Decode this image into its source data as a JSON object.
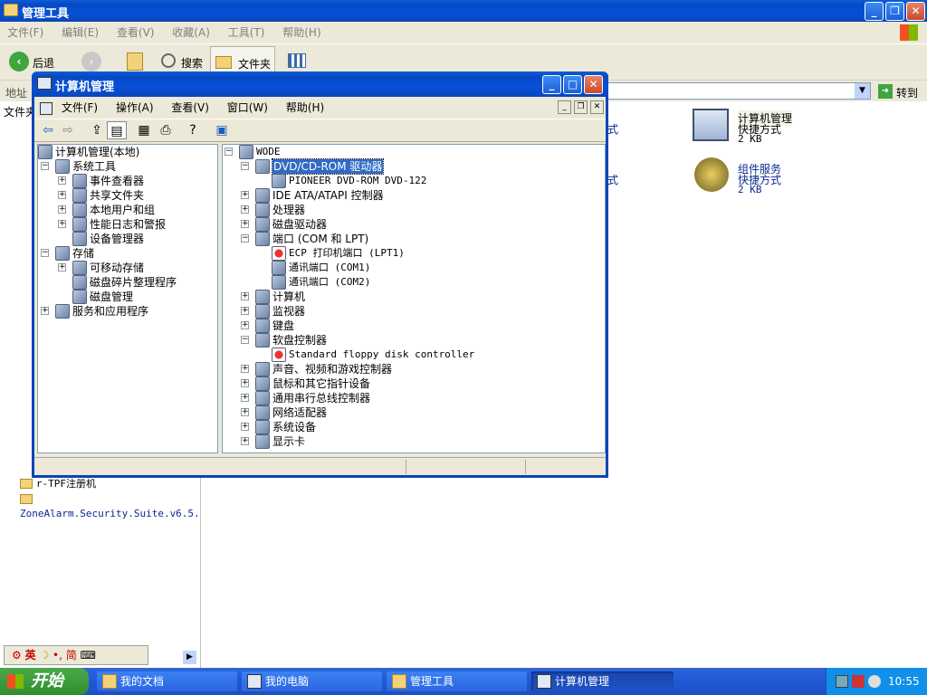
{
  "bg_window": {
    "title": "管理工具",
    "menu": [
      "文件(F)",
      "编辑(E)",
      "查看(V)",
      "收藏(A)",
      "工具(T)",
      "帮助(H)"
    ],
    "toolbar": {
      "back": "后退",
      "search": "搜索",
      "folders": "文件夹"
    },
    "address_label": "地址",
    "go_label": "转到",
    "left_header": "文件夹",
    "left_tree_tail": [
      "r-TPF注册机",
      "ZoneAlarm.Security.Suite.v6.5."
    ],
    "right_items": [
      {
        "name": "计算机管理",
        "type": "快捷方式",
        "size": "2 KB"
      },
      {
        "name": "组件服务",
        "type": "快捷方式",
        "size": "2 KB"
      }
    ],
    "partial_text": [
      "式",
      "式"
    ]
  },
  "mmc": {
    "title": "计算机管理",
    "menu": [
      "文件(F)",
      "操作(A)",
      "查看(V)",
      "窗口(W)",
      "帮助(H)"
    ],
    "left_tree": [
      {
        "label": "计算机管理(本地)",
        "level": 0,
        "exp": "",
        "icon": "computer-mgmt-icon"
      },
      {
        "label": "系统工具",
        "level": 1,
        "exp": "−",
        "icon": "system-tools-icon"
      },
      {
        "label": "事件查看器",
        "level": 2,
        "exp": "+",
        "icon": "event-viewer-icon"
      },
      {
        "label": "共享文件夹",
        "level": 2,
        "exp": "+",
        "icon": "shared-folder-icon"
      },
      {
        "label": "本地用户和组",
        "level": 2,
        "exp": "+",
        "icon": "users-icon"
      },
      {
        "label": "性能日志和警报",
        "level": 2,
        "exp": "+",
        "icon": "perf-log-icon"
      },
      {
        "label": "设备管理器",
        "level": 2,
        "exp": "",
        "icon": "device-manager-icon"
      },
      {
        "label": "存储",
        "level": 1,
        "exp": "−",
        "icon": "storage-icon"
      },
      {
        "label": "可移动存储",
        "level": 2,
        "exp": "+",
        "icon": "removable-storage-icon"
      },
      {
        "label": "磁盘碎片整理程序",
        "level": 2,
        "exp": "",
        "icon": "defrag-icon"
      },
      {
        "label": "磁盘管理",
        "level": 2,
        "exp": "",
        "icon": "disk-mgmt-icon"
      },
      {
        "label": "服务和应用程序",
        "level": 1,
        "exp": "+",
        "icon": "services-icon"
      }
    ],
    "device_tree": [
      {
        "label": "WODE",
        "level": 0,
        "exp": "−",
        "icon": "computer-icon"
      },
      {
        "label": "DVD/CD-ROM 驱动器",
        "level": 1,
        "exp": "−",
        "icon": "cdrom-icon",
        "selected": true
      },
      {
        "label": "PIONEER DVD-ROM DVD-122",
        "level": 2,
        "exp": "",
        "icon": "cdrom-icon"
      },
      {
        "label": "IDE ATA/ATAPI 控制器",
        "level": 1,
        "exp": "+",
        "icon": "ide-icon"
      },
      {
        "label": "处理器",
        "level": 1,
        "exp": "+",
        "icon": "cpu-icon"
      },
      {
        "label": "磁盘驱动器",
        "level": 1,
        "exp": "+",
        "icon": "disk-drive-icon"
      },
      {
        "label": "端口 (COM 和 LPT)",
        "level": 1,
        "exp": "−",
        "icon": "port-icon"
      },
      {
        "label": "ECP 打印机端口 (LPT1)",
        "level": 2,
        "exp": "",
        "icon": "port-error-icon"
      },
      {
        "label": "通讯端口 (COM1)",
        "level": 2,
        "exp": "",
        "icon": "port-icon"
      },
      {
        "label": "通讯端口 (COM2)",
        "level": 2,
        "exp": "",
        "icon": "port-icon"
      },
      {
        "label": "计算机",
        "level": 1,
        "exp": "+",
        "icon": "computer-icon"
      },
      {
        "label": "监视器",
        "level": 1,
        "exp": "+",
        "icon": "monitor-icon"
      },
      {
        "label": "键盘",
        "level": 1,
        "exp": "+",
        "icon": "keyboard-icon"
      },
      {
        "label": "软盘控制器",
        "level": 1,
        "exp": "−",
        "icon": "floppy-icon"
      },
      {
        "label": "Standard floppy disk controller",
        "level": 2,
        "exp": "",
        "icon": "floppy-error-icon"
      },
      {
        "label": "声音、视频和游戏控制器",
        "level": 1,
        "exp": "+",
        "icon": "sound-icon"
      },
      {
        "label": "鼠标和其它指针设备",
        "level": 1,
        "exp": "+",
        "icon": "mouse-icon"
      },
      {
        "label": "通用串行总线控制器",
        "level": 1,
        "exp": "+",
        "icon": "usb-icon"
      },
      {
        "label": "网络适配器",
        "level": 1,
        "exp": "+",
        "icon": "network-icon"
      },
      {
        "label": "系统设备",
        "level": 1,
        "exp": "+",
        "icon": "system-device-icon"
      },
      {
        "label": "显示卡",
        "level": 1,
        "exp": "+",
        "icon": "display-icon"
      }
    ]
  },
  "ime": {
    "label": "英",
    "simplified": "简"
  },
  "taskbar": {
    "start": "开始",
    "tasks": [
      "我的文档",
      "我的电脑",
      "管理工具",
      "计算机管理"
    ],
    "clock": "10:55"
  },
  "colors": {
    "xp_blue": "#0a5fd8",
    "taskbar": "#245edc",
    "start_green": "#3c9a3c",
    "tray": "#0f8fe8",
    "selection": "#316ac5"
  }
}
